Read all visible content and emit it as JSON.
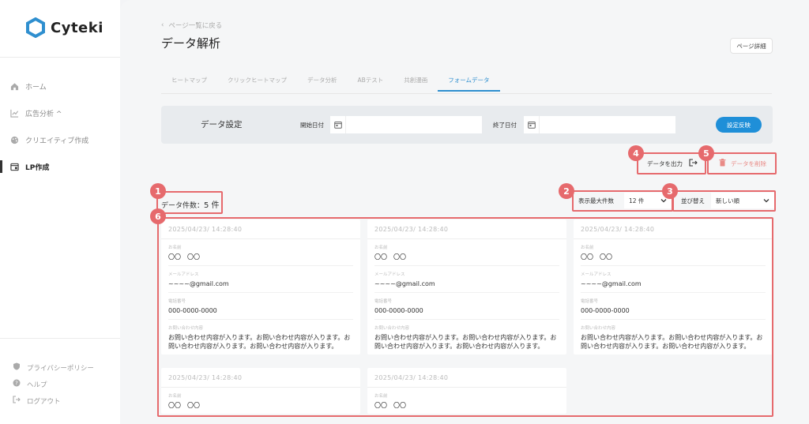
{
  "brand": {
    "name": "Cyteki",
    "accent": "#2f8fcf",
    "annotation_color": "#e66a6d"
  },
  "sidebar": {
    "items": [
      {
        "label": "ホーム",
        "icon": "home-icon"
      },
      {
        "label": "広告分析 ^",
        "icon": "chart-line-icon"
      },
      {
        "label": "クリエイティブ作成",
        "icon": "palette-icon"
      },
      {
        "label": "LP作成",
        "icon": "lp-icon",
        "active": true
      }
    ],
    "footer": [
      {
        "label": "プライバシーポリシー",
        "icon": "shield-icon"
      },
      {
        "label": "ヘルプ",
        "icon": "help-icon"
      },
      {
        "label": "ログアウト",
        "icon": "logout-icon"
      }
    ]
  },
  "header": {
    "back_label": "ページ一覧に戻る",
    "title": "データ解析",
    "detail_button": "ページ詳細"
  },
  "tabs": [
    {
      "label": "ヒートマップ"
    },
    {
      "label": "クリックヒートマップ"
    },
    {
      "label": "データ分析"
    },
    {
      "label": "ABテスト"
    },
    {
      "label": "共創漫画"
    },
    {
      "label": "フォームデータ",
      "active": true
    }
  ],
  "settings": {
    "title": "データ設定",
    "start_label": "開始日付",
    "end_label": "終了日付",
    "start_value": "",
    "end_value": "",
    "apply_button": "設定反映"
  },
  "actions": {
    "export_label": "データを出力",
    "delete_label": "データを削除"
  },
  "list": {
    "count_prefix": "データ件数：",
    "count_value": "5 件",
    "limit_label": "表示最大件数",
    "limit_value": "12 件",
    "sort_label": "並び替え",
    "sort_value": "新しい順"
  },
  "field_labels": {
    "name": "お名前",
    "email": "メールアドレス",
    "phone": "電話番号",
    "inquiry": "お問い合わせ内容"
  },
  "cards": [
    {
      "date": "2025/04/23/ 14:28:40",
      "name": "〇〇　〇〇",
      "email": "~~~~@gmail.com",
      "phone": "000-0000-0000",
      "inquiry": "お問い合わせ内容が入ります。お問い合わせ内容が入ります。お問い合わせ内容が入ります。お問い合わせ内容が入ります。"
    },
    {
      "date": "2025/04/23/ 14:28:40",
      "name": "〇〇　〇〇",
      "email": "~~~~@gmail.com",
      "phone": "000-0000-0000",
      "inquiry": "お問い合わせ内容が入ります。お問い合わせ内容が入ります。お問い合わせ内容が入ります。お問い合わせ内容が入ります。"
    },
    {
      "date": "2025/04/23/ 14:28:40",
      "name": "〇〇　〇〇",
      "email": "~~~~@gmail.com",
      "phone": "000-0000-0000",
      "inquiry": "お問い合わせ内容が入ります。お問い合わせ内容が入ります。お問い合わせ内容が入ります。お問い合わせ内容が入ります。"
    },
    {
      "date": "2025/04/23/ 14:28:40",
      "name": "〇〇　〇〇"
    },
    {
      "date": "2025/04/23/ 14:28:40",
      "name": "〇〇　〇〇"
    }
  ],
  "annotations": [
    "1",
    "2",
    "3",
    "4",
    "5",
    "6"
  ]
}
